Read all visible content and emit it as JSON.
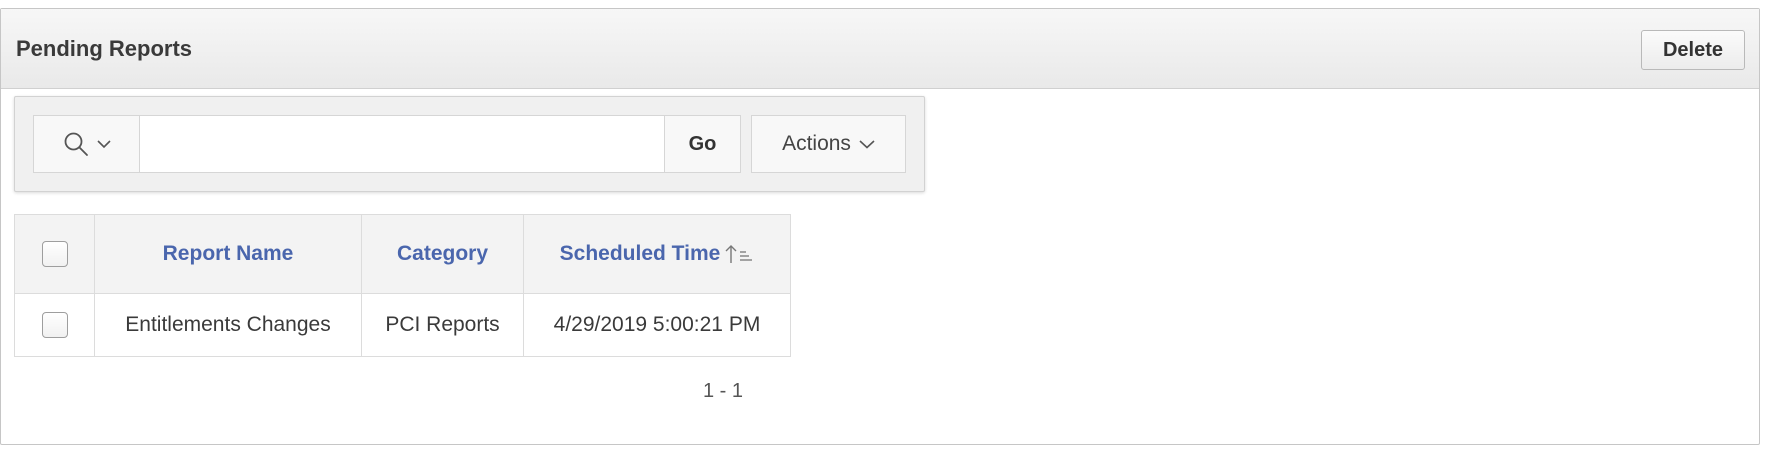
{
  "region": {
    "title": "Pending Reports",
    "delete_label": "Delete"
  },
  "toolbar": {
    "search_value": "",
    "search_placeholder": "",
    "go_label": "Go",
    "actions_label": "Actions"
  },
  "table": {
    "columns": {
      "select_all": "",
      "report_name": "Report Name",
      "category": "Category",
      "scheduled_time": "Scheduled Time"
    },
    "sort": {
      "column": "Scheduled Time",
      "direction": "ascending"
    },
    "rows": [
      {
        "selected": false,
        "report_name": "Entitlements Changes",
        "category": "PCI Reports",
        "scheduled_time": "4/29/2019 5:00:21 PM"
      }
    ]
  },
  "pagination": {
    "label": "1 - 1"
  },
  "icons": {
    "search": "search-icon",
    "chevron": "chevron-down-icon",
    "sort": "sort-ascending-icon"
  },
  "colors": {
    "header_link": "#4a66ad",
    "header_bg": "#e9e9e9"
  }
}
